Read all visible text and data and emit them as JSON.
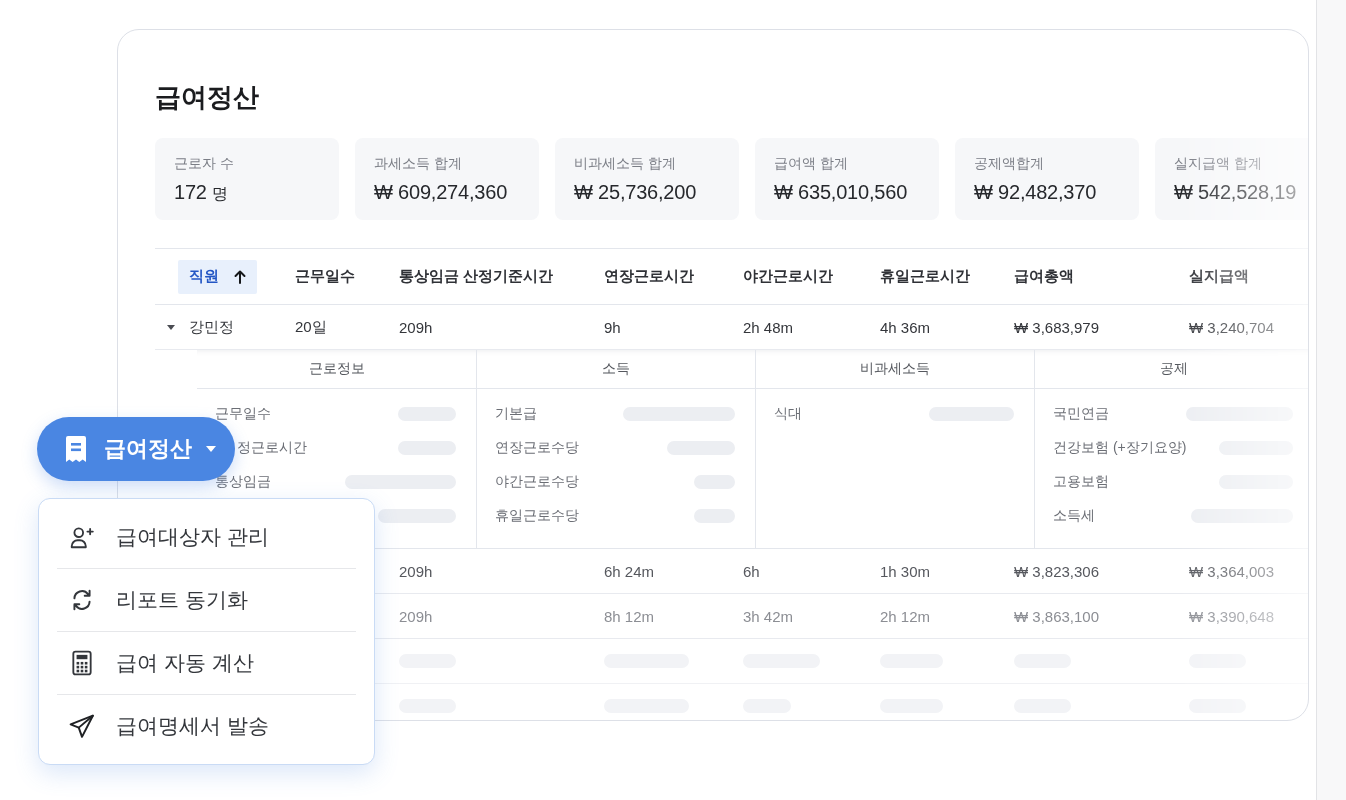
{
  "page": {
    "title": "급여정산"
  },
  "stats": [
    {
      "label": "근로자 수",
      "value": "172",
      "unit": "명"
    },
    {
      "label": "과세소득 합계",
      "value": "₩ 609,274,360"
    },
    {
      "label": "비과세소득 합계",
      "value": "₩ 25,736,200"
    },
    {
      "label": "급여액 합계",
      "value": "₩ 635,010,560"
    },
    {
      "label": "공제액합계",
      "value": "₩ 92,482,370"
    },
    {
      "label": "실지급액 합계",
      "value": "₩ 542,528,19"
    }
  ],
  "table": {
    "columns": [
      {
        "label": "직원",
        "sorted": true
      },
      {
        "label": "근무일수",
        "sorted": false
      },
      {
        "label": "통상임금 산정기준시간",
        "sorted": false
      },
      {
        "label": "연장근로시간",
        "sorted": false
      },
      {
        "label": "야간근로시간",
        "sorted": false
      },
      {
        "label": "휴일근로시간",
        "sorted": false
      },
      {
        "label": "급여총액",
        "sorted": false
      },
      {
        "label": "실지급액",
        "sorted": false
      }
    ],
    "rows": [
      {
        "kind": "data",
        "expanded": true,
        "cells": {
          "employee": "강민정",
          "work_days": "20일",
          "standard_hours": "209h",
          "overtime_hours": "9h",
          "night_hours": "2h 48m",
          "holiday_hours": "4h 36m",
          "gross_pay": "₩ 3,683,979",
          "net_pay": "₩ 3,240,704"
        },
        "details": [
          {
            "title": "근로정보",
            "items": [
              {
                "label": "근무일수",
                "loading": true
              },
              {
                "label": "정근로시간",
                "loading": true
              },
              {
                "label": "통상임금",
                "loading": true
              },
              {
                "loading": true
              }
            ]
          },
          {
            "title": "소득",
            "items": [
              {
                "label": "기본급",
                "loading": true
              },
              {
                "label": "연장근로수당",
                "loading": true
              },
              {
                "label": "야간근로수당",
                "loading": true
              },
              {
                "label": "휴일근로수당",
                "loading": true
              }
            ]
          },
          {
            "title": "비과세소득",
            "items": [
              {
                "label": "식대",
                "loading": true
              }
            ]
          },
          {
            "title": "공제",
            "items": [
              {
                "label": "국민연금",
                "loading": true
              },
              {
                "label": "건강보험 (+장기요양)",
                "loading": true
              },
              {
                "label": "고용보험",
                "loading": true
              },
              {
                "label": "소득세",
                "loading": true
              }
            ]
          }
        ]
      },
      {
        "kind": "data",
        "cells": {
          "standard_hours": "209h",
          "overtime_hours": "6h 24m",
          "night_hours": "6h",
          "holiday_hours": "1h 30m",
          "gross_pay": "₩ 3,823,306",
          "net_pay": "₩ 3,364,003"
        }
      },
      {
        "kind": "data",
        "cells": {
          "standard_hours": "209h",
          "overtime_hours": "8h 12m",
          "night_hours": "3h 42m",
          "holiday_hours": "2h 12m",
          "gross_pay": "₩ 3,863,100",
          "net_pay": "₩ 3,390,648"
        }
      },
      {
        "kind": "skeleton"
      },
      {
        "kind": "skeleton"
      }
    ]
  },
  "action_button": {
    "label": "급여정산",
    "menu": {
      "open": true,
      "items": [
        {
          "label": "급여대상자 관리"
        },
        {
          "label": "리포트 동기화"
        },
        {
          "label": "급여 자동 계산"
        },
        {
          "label": "급여명세서 발송"
        }
      ]
    }
  }
}
